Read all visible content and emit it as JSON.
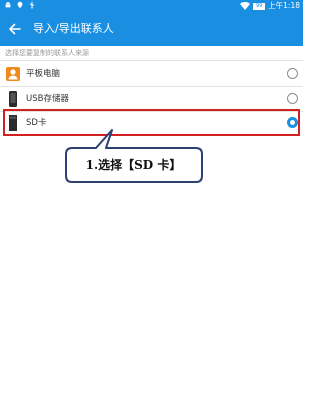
{
  "status_bar": {
    "time": "上午1:18",
    "battery_label": "99",
    "icons": [
      "android-icon",
      "location-icon",
      "usb-icon",
      "wifi-icon",
      "battery-icon"
    ]
  },
  "app_bar": {
    "title": "导入/导出联系人",
    "back_icon": "arrow-left-icon"
  },
  "section_label": "选择您要复制的联系人来源",
  "sources": [
    {
      "label": "平板电脑",
      "icon": "person-icon",
      "selected": false
    },
    {
      "label": "USB存储器",
      "icon": "usb-storage-icon",
      "selected": false
    },
    {
      "label": "SD卡",
      "icon": "sd-card-icon",
      "selected": true
    }
  ],
  "annotation": {
    "text": "1.选择【SD 卡】",
    "highlight_color": "#d32020",
    "callout_border": "#2d3f73"
  },
  "colors": {
    "accent": "#1a8ee0",
    "highlight": "#d32020"
  }
}
